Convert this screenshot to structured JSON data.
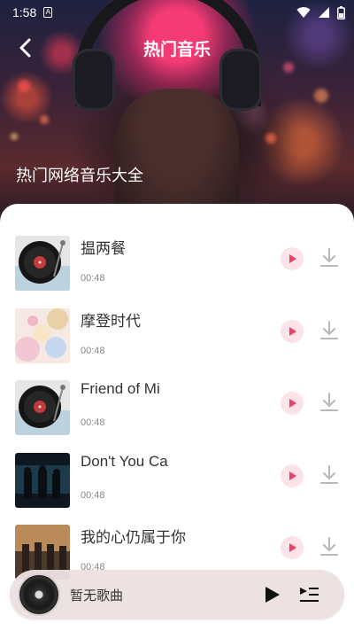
{
  "status_bar": {
    "time": "1:58"
  },
  "header": {
    "title": "热门音乐"
  },
  "hero": {
    "subtitle": "热门网络音乐大全"
  },
  "songs": [
    {
      "title": "揾两餐",
      "duration": "00:48",
      "art": "vinyl"
    },
    {
      "title": "摩登时代",
      "duration": "00:48",
      "art": "pastel"
    },
    {
      "title": "Friend of Mi",
      "duration": "00:48",
      "art": "vinyl"
    },
    {
      "title": "Don't You Ca",
      "duration": "00:48",
      "art": "dark-band"
    },
    {
      "title": "我的心仍属于你",
      "duration": "00:48",
      "art": "sunset-band"
    }
  ],
  "player": {
    "now_playing": "暂无歌曲"
  },
  "colors": {
    "accent": "#f23c63",
    "play_bg": "#fbe3e8",
    "player_bg": "#ece1e1"
  }
}
